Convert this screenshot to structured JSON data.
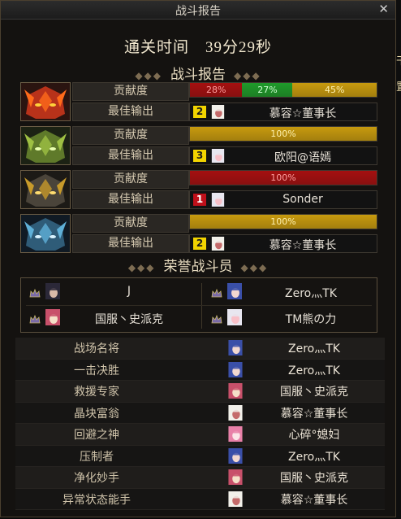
{
  "window": {
    "title": "战斗报告",
    "close_icon": "close-icon"
  },
  "clear_time": "通关时间　39分29秒",
  "battle_report": {
    "header": "战斗报告",
    "contribution_label": "贡献度",
    "best_output_label": "最佳输出",
    "rows": [
      {
        "boss_icon": "flame-demon-helm-icon",
        "segments": [
          {
            "text": "28%",
            "value": 28,
            "color": "#a51010",
            "text_color": "#ff9e9e"
          },
          {
            "text": "27%",
            "value": 27,
            "color": "#1f9a2a",
            "text_color": "#cfffd2"
          },
          {
            "text": "45%",
            "value": 45,
            "color": "#c79a0e",
            "text_color": "#fff2b0"
          }
        ],
        "rank": "2",
        "rank_color": "#f2d400",
        "player": "慕容☆董事长"
      },
      {
        "boss_icon": "green-spiked-helm-icon",
        "segments": [
          {
            "text": "100%",
            "value": 100,
            "color": "#c79a0e",
            "text_color": "#fff2b0"
          }
        ],
        "rank": "3",
        "rank_color": "#f2d400",
        "player": "欧阳@语嫣"
      },
      {
        "boss_icon": "gold-horned-helm-icon",
        "segments": [
          {
            "text": "100%",
            "value": 100,
            "color": "#a51010",
            "text_color": "#ff9e9e"
          }
        ],
        "rank": "1",
        "rank_color": "#c0101a",
        "player": "Sonder"
      },
      {
        "boss_icon": "blue-armored-helm-icon",
        "segments": [
          {
            "text": "100%",
            "value": 100,
            "color": "#c79a0e",
            "text_color": "#fff2b0"
          }
        ],
        "rank": "2",
        "rank_color": "#f2d400",
        "player": "慕容☆董事长"
      }
    ]
  },
  "honor": {
    "header": "荣誉战斗员",
    "members": [
      {
        "name": "J",
        "avatar": "dark-hair-avatar"
      },
      {
        "name": "Zero灬TK",
        "avatar": "blue-hair-avatar"
      },
      {
        "name": "国服丶史派克",
        "avatar": "pink-gunner-avatar"
      },
      {
        "name": "TM熊の力",
        "avatar": "silver-mage-avatar"
      }
    ]
  },
  "awards": [
    {
      "title": "战场名将",
      "winner": "Zero灬TK",
      "avatar": "blue-hair-avatar"
    },
    {
      "title": "一击决胜",
      "winner": "Zero灬TK",
      "avatar": "blue-hair-avatar"
    },
    {
      "title": "救援专家",
      "winner": "国服丶史派克",
      "avatar": "pink-gunner-avatar"
    },
    {
      "title": "晶块富翁",
      "winner": "慕容☆董事长",
      "avatar": "white-hair-avatar"
    },
    {
      "title": "回避之神",
      "winner": "心碎°媳妇",
      "avatar": "pink-hair-avatar"
    },
    {
      "title": "压制者",
      "winner": "Zero灬TK",
      "avatar": "blue-hair-avatar"
    },
    {
      "title": "净化妙手",
      "winner": "国服丶史派克",
      "avatar": "pink-gunner-avatar"
    },
    {
      "title": "异常状态能手",
      "winner": "慕容☆董事长",
      "avatar": "white-hair-avatar"
    }
  ],
  "side_strip": [
    "干",
    "置"
  ]
}
